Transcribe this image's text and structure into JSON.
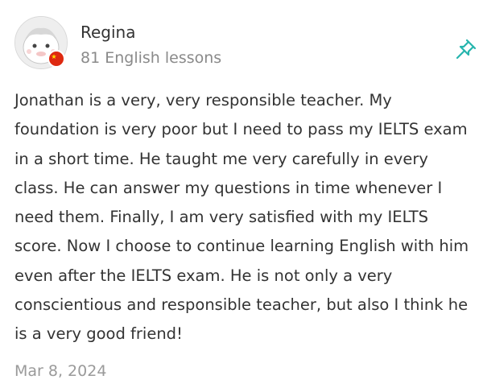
{
  "review": {
    "author_name": "Regina",
    "lessons_count": "81 English lessons",
    "body": "Jonathan is a very, very responsible teacher. My foundation is very poor but I need to pass my IELTS exam in a short time. He taught me very carefully in every class. He can answer my questions in time whenever I need them. Finally, I am very satisfied with my IELTS score. Now I choose to continue learning English with him even after the IELTS exam. He is not only a very conscientious and responsible teacher, but also I think he is a very good friend!",
    "date": "Mar 8, 2024"
  },
  "icons": {
    "avatar": "avatar-image",
    "flag": "china-flag-icon",
    "pin": "pin-icon"
  },
  "colors": {
    "pin_accent": "#26b5ad",
    "text": "#333333",
    "muted": "#8a8a8a",
    "flag_red": "#de2910",
    "flag_star": "#ffde00"
  }
}
